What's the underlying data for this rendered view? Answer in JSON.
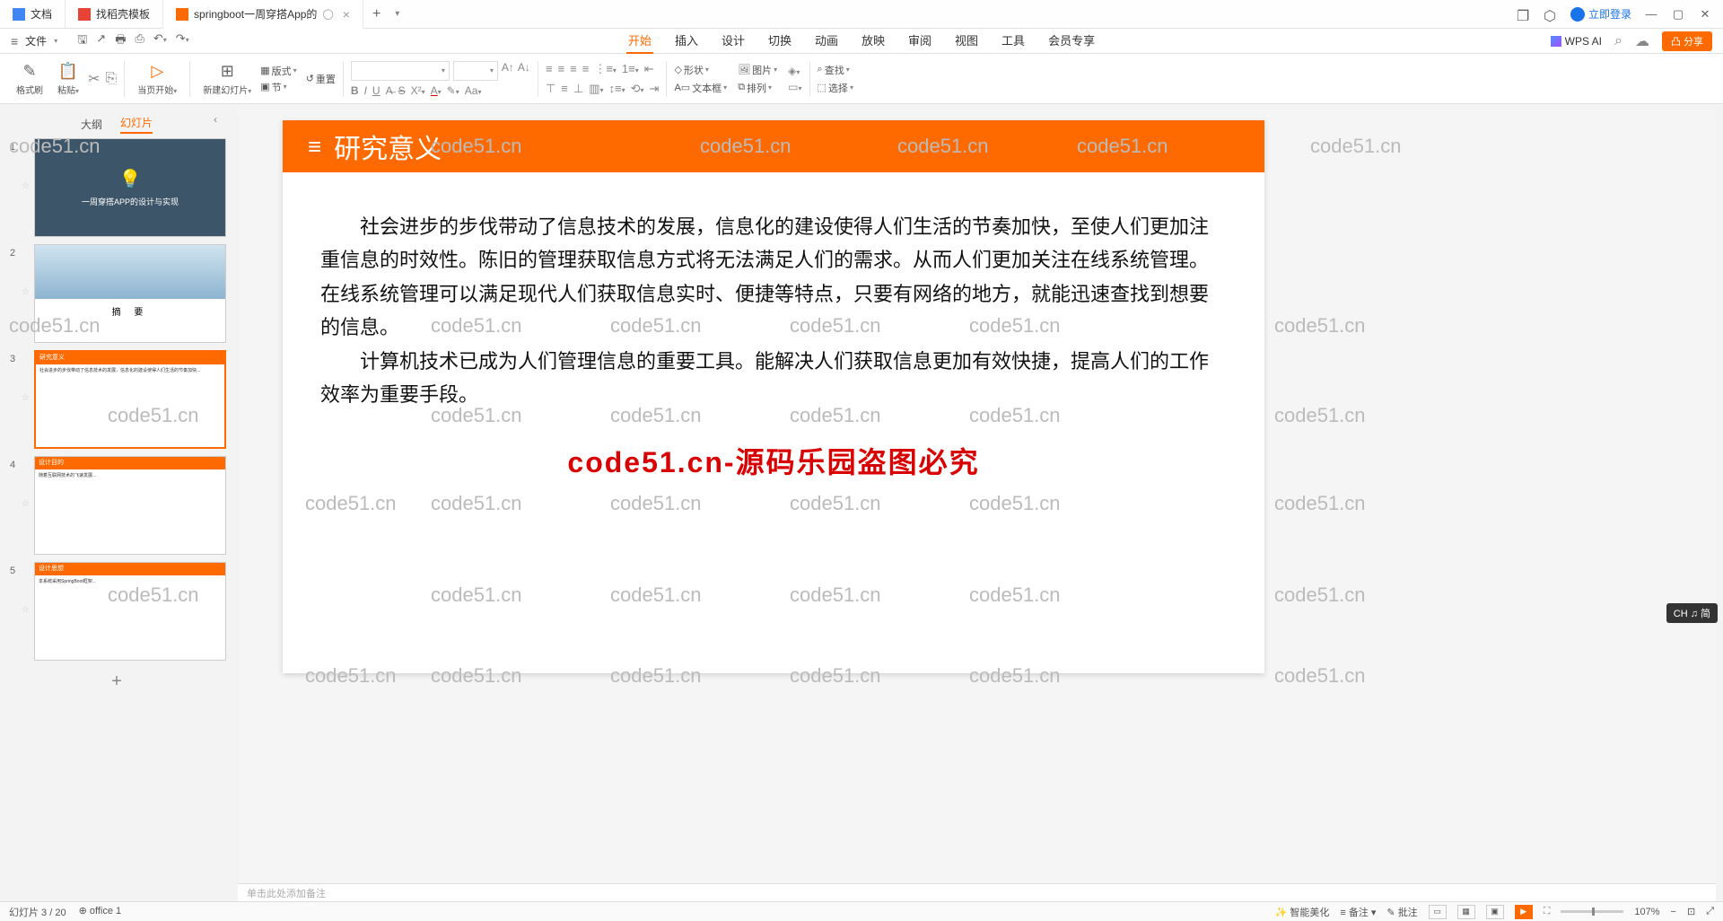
{
  "tabs": [
    {
      "icon_bg": "#4285f4",
      "label": "文档"
    },
    {
      "icon_bg": "#e94335",
      "label": "找稻壳模板"
    },
    {
      "icon_bg": "#ff6a00",
      "label": "springboot一周穿搭App的",
      "active": true
    }
  ],
  "title_actions": {
    "login": "立即登录"
  },
  "menu": {
    "file": "文件"
  },
  "ribbon_tabs": [
    "开始",
    "插入",
    "设计",
    "切换",
    "动画",
    "放映",
    "审阅",
    "视图",
    "工具",
    "会员专享"
  ],
  "ribbon_active": 0,
  "wps_ai": "WPS AI",
  "share_label": "分享",
  "ribbon": {
    "format_painter": "格式刷",
    "paste": "粘贴",
    "from_current": "当页开始",
    "new_slide": "新建幻灯片",
    "layout": "版式",
    "reset": "重置",
    "section": "节",
    "shape": "形状",
    "picture": "图片",
    "textbox": "文本框",
    "arrange": "排列",
    "find": "查找",
    "select": "选择"
  },
  "panel": {
    "outline": "大纲",
    "slides": "幻灯片"
  },
  "thumbs": [
    {
      "title": "一周穿搭APP的设计与实现"
    },
    {
      "caption": "摘  要"
    },
    {
      "bar": "研究意义"
    },
    {
      "bar": "设计目的"
    },
    {
      "bar": "设计思想"
    }
  ],
  "slide": {
    "title": "研究意义",
    "para1": "社会进步的步伐带动了信息技术的发展，信息化的建设使得人们生活的节奏加快，至使人们更加注重信息的时效性。陈旧的管理获取信息方式将无法满足人们的需求。从而人们更加关注在线系统管理。在线系统管理可以满足现代人们获取信息实时、便捷等特点，只要有网络的地方，就能迅速查找到想要的信息。",
    "para2": "计算机技术已成为人们管理信息的重要工具。能解决人们获取信息更加有效快捷，提高人们的工作效率为重要手段。",
    "watermark_big": "code51.cn-源码乐园盗图必究"
  },
  "notes_placeholder": "单击此处添加备注",
  "status": {
    "slide_pos": "幻灯片 3 / 20",
    "office": "office 1",
    "beautify": "智能美化",
    "notes": "备注",
    "comments": "批注",
    "zoom": "107%"
  },
  "ime": "CH ♫ 简",
  "watermark_text": "code51.cn"
}
